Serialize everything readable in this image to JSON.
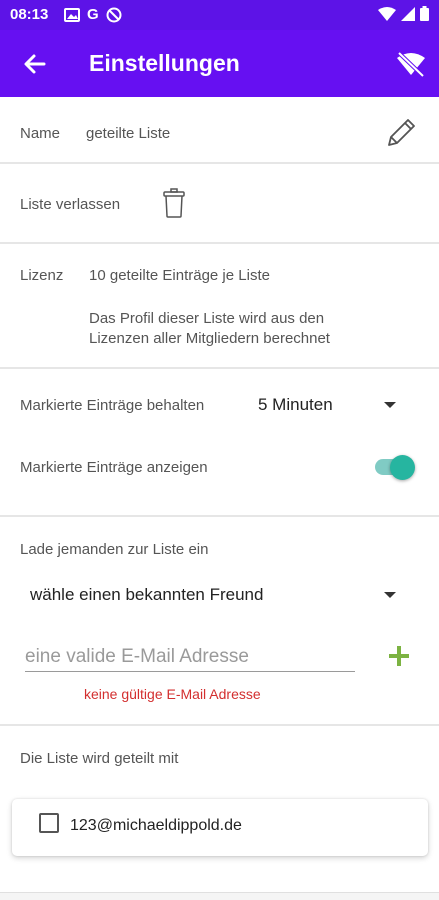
{
  "status_bar": {
    "time": "08:13",
    "left_icons": [
      "image-icon",
      "google-icon",
      "vpn-icon"
    ],
    "right_icons": [
      "wifi-icon",
      "signal-icon",
      "battery-icon"
    ]
  },
  "app_bar": {
    "title": "Einstellungen",
    "back_icon": "arrow-left-icon",
    "action_icon": "wifi-off-icon",
    "color": "#6610f2"
  },
  "name_row": {
    "label": "Name",
    "value": "geteilte Liste",
    "edit_icon": "pencil-icon"
  },
  "leave_row": {
    "label": "Liste verlassen",
    "icon": "trash-icon"
  },
  "license_row": {
    "label": "Lizenz",
    "value": "10 geteilte Einträge je Liste",
    "description_line1": "Das Profil dieser Liste wird aus den",
    "description_line2": "Lizenzen aller Mitgliedern berechnet"
  },
  "marked_keep_row": {
    "label": "Markierte Einträge behalten",
    "selected": "5 Minuten"
  },
  "marked_show_row": {
    "label": "Markierte Einträge anzeigen",
    "toggle_on": true,
    "toggle_color": "#26b5a0"
  },
  "invite": {
    "label": "Lade jemanden zur Liste ein",
    "friend_select": "wähle einen bekannten Freund",
    "email_placeholder": "eine valide E-Mail Adresse",
    "email_value": "",
    "add_icon": "plus-icon",
    "add_color": "#7cb342",
    "error": "keine gültige E-Mail Adresse",
    "error_color": "#d32f2f"
  },
  "shared": {
    "label": "Die Liste wird geteilt mit",
    "members": [
      {
        "email": "123@michaeldippold.de",
        "checked": false
      }
    ]
  }
}
